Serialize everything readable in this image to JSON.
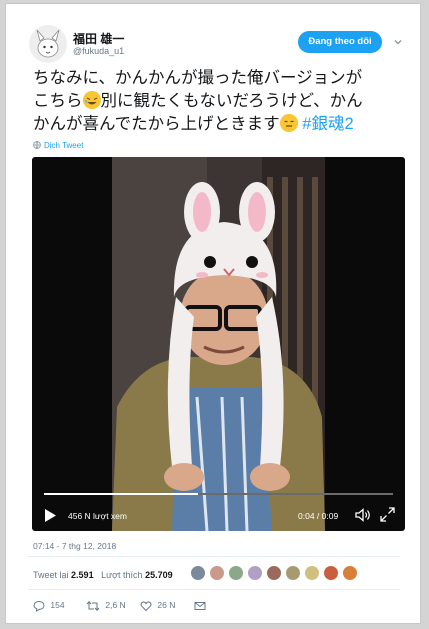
{
  "user": {
    "name": "福田 雄一",
    "handle": "@fukuda_u1",
    "follow_label": "Đang theo dõi"
  },
  "tweet": {
    "line1": "ちなみに、かんかんが撮った俺バージョンが",
    "line2_a": "こちら",
    "line2_b": "別に観たくもないだろうけど、かん",
    "line3_a": "かんが喜んでたから上げときます",
    "hashtag": "#銀魂2",
    "translate": "Dịch Tweet"
  },
  "video": {
    "views": "456 N lượt xem",
    "time": "0:04 / 0:09",
    "progress": 0.44
  },
  "meta": {
    "date": "07:14 - 7 thg 12, 2018"
  },
  "stats": {
    "retweets_label": "Tweet lại",
    "retweets": "2.591",
    "likes_label": "Lượt thích",
    "likes": "25.709"
  },
  "actions": {
    "replies": "154",
    "retweets": "2,6 N",
    "likes": "26 N"
  },
  "colors": {
    "accent": "#1da1f2",
    "text": "#14171a",
    "muted": "#657786"
  }
}
